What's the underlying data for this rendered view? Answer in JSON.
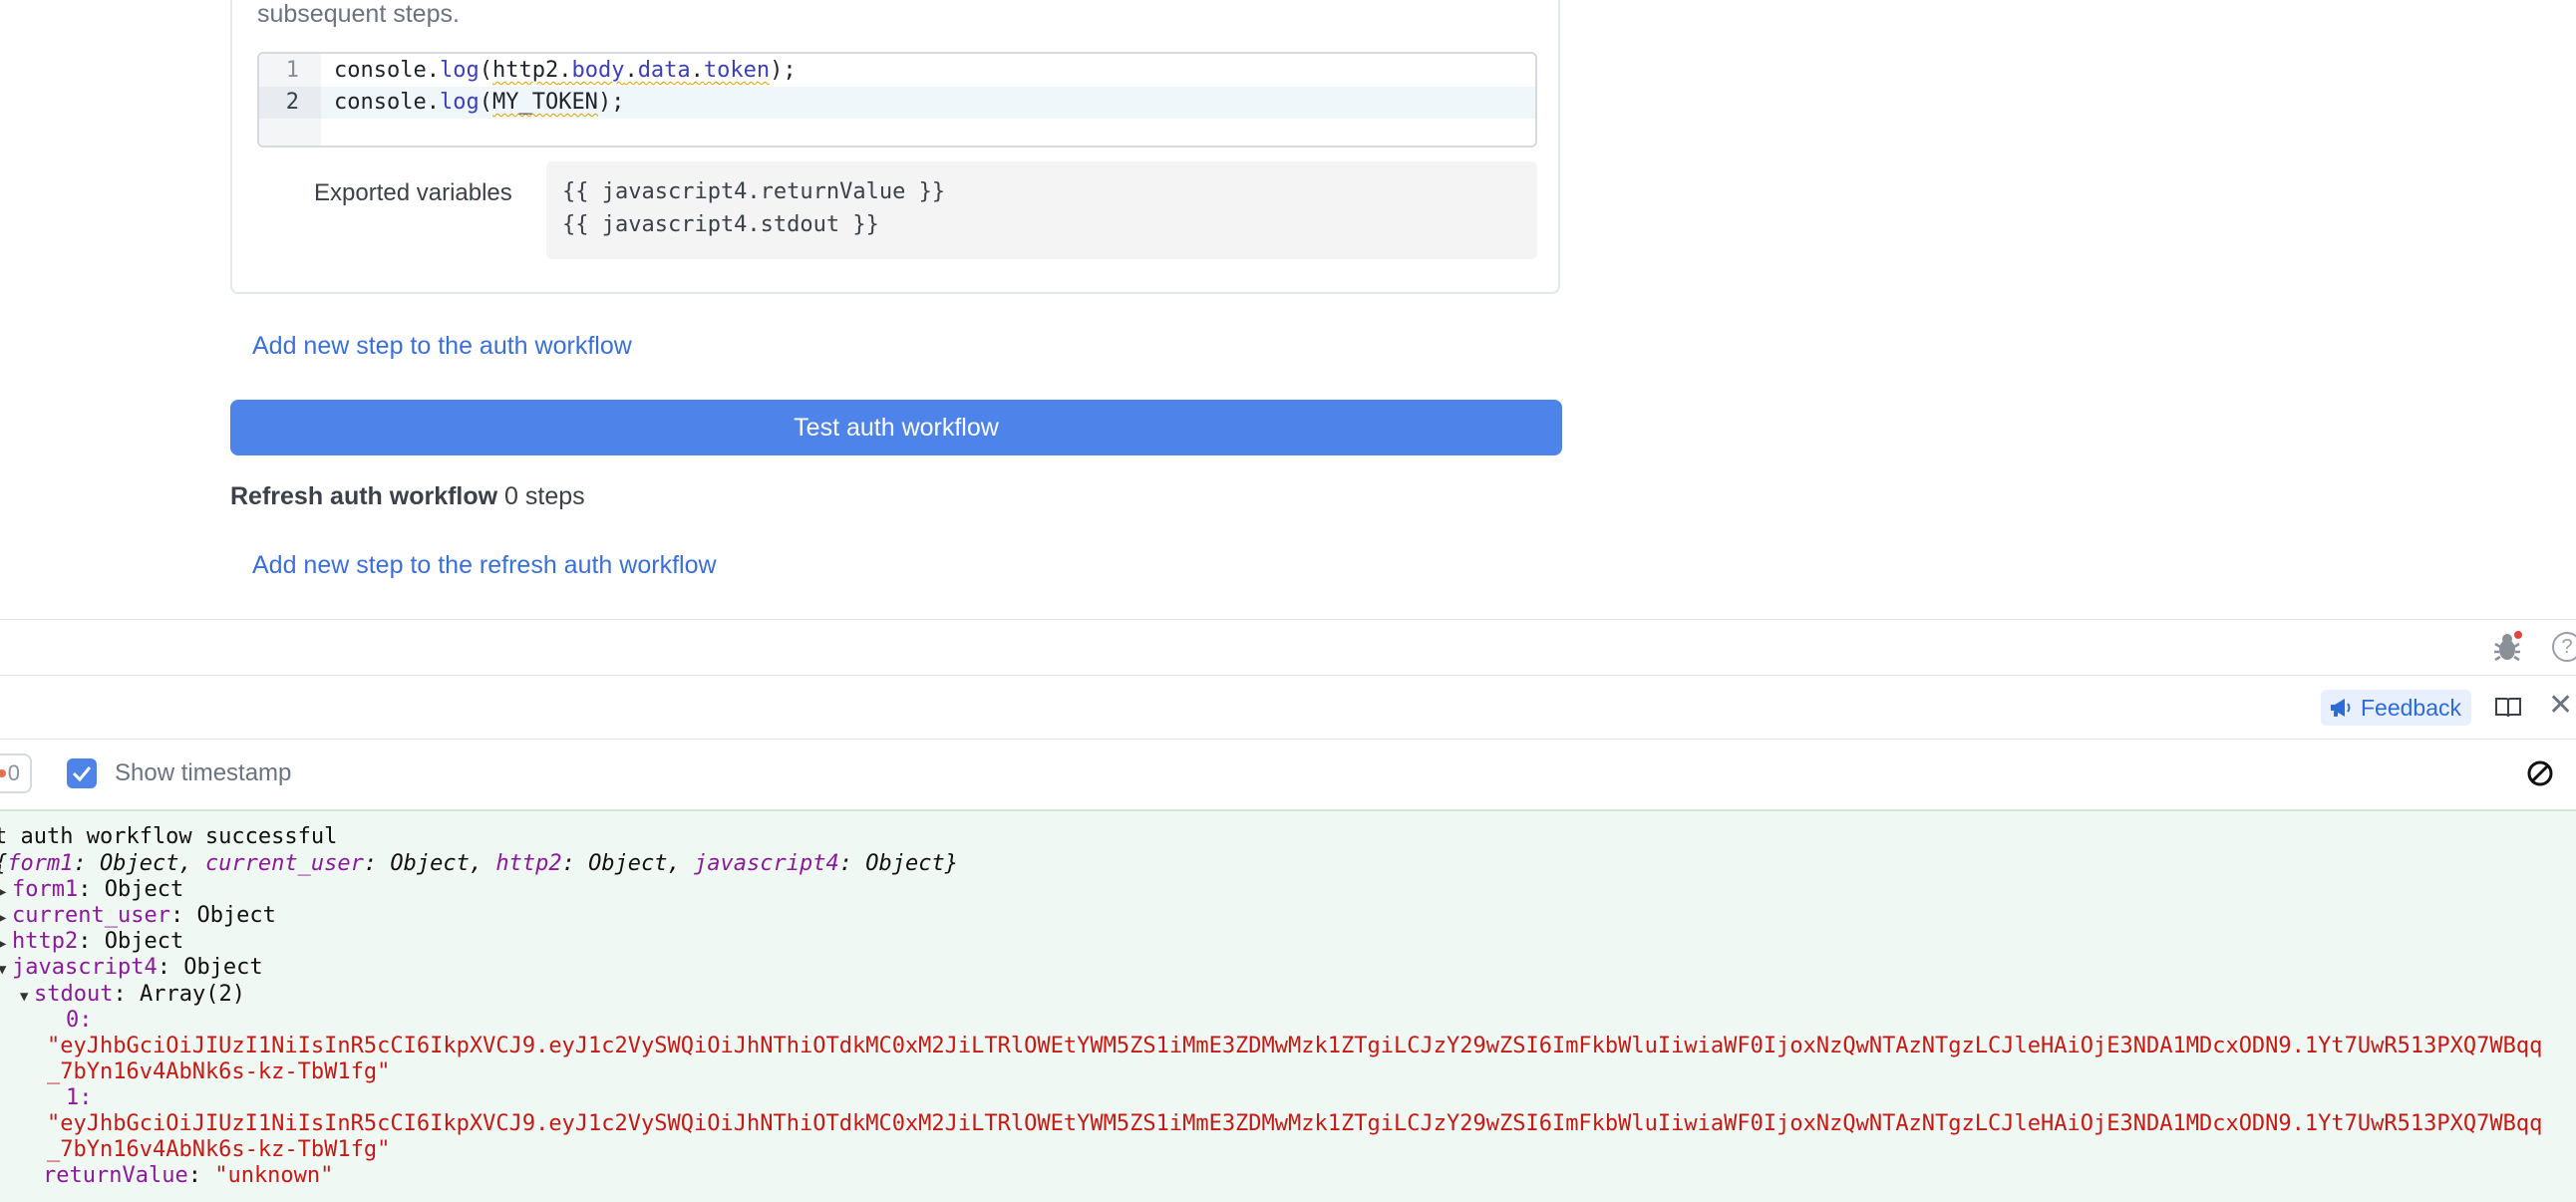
{
  "step": {
    "description_tail": "subsequent steps.",
    "code_lines": [
      {
        "num": "1",
        "pre": "console.",
        "fn": "log",
        "open": "(",
        "obj": "http2",
        "dot1": ".",
        "p1": "body",
        "dot2": ".",
        "p2": "data",
        "dot3": ".",
        "p3": "token",
        "close": ");"
      },
      {
        "num": "2",
        "pre": "console.",
        "fn": "log",
        "open": "(",
        "arg": "MY_TOKEN",
        "close": ");"
      }
    ],
    "exported_label": "Exported variables",
    "exported_values": [
      "{{ javascript4.returnValue }}",
      "{{ javascript4.stdout }}"
    ]
  },
  "links": {
    "add_auth_step": "Add new step to the auth workflow",
    "add_refresh_step": "Add new step to the refresh auth workflow"
  },
  "test_button": "Test auth workflow",
  "refresh": {
    "title": "Refresh auth workflow",
    "steps": "0 steps"
  },
  "panel": {
    "feedback": "Feedback",
    "count": "0",
    "show_timestamp": "Show timestamp",
    "show_timestamp_checked": true
  },
  "console": {
    "status": "t auth workflow successful",
    "summary": {
      "open": "{",
      "k1": "form1",
      "v1": ": Object, ",
      "k2": "current_user",
      "v2": ": Object, ",
      "k3": "http2",
      "v3": ": Object, ",
      "k4": "javascript4",
      "v4": ": Object}"
    },
    "entries": [
      {
        "key": "form1",
        "value": ": Object"
      },
      {
        "key": "current_user",
        "value": ": Object"
      },
      {
        "key": "http2",
        "value": ": Object"
      },
      {
        "key": "javascript4",
        "value": ": Object"
      }
    ],
    "stdout_key": "stdout",
    "stdout_value": ": Array(2)",
    "item0_key": "0:",
    "item0_line1": "\"eyJhbGciOiJIUzI1NiIsInR5cCI6IkpXVCJ9.eyJ1c2VySWQiOiJhNThiOTdkMC0xM2JiLTRlOWEtYWM5ZS1iMmE3ZDMwMzk1ZTgiLCJzY29wZSI6ImFkbWluIiwiaWF0IjoxNzQwNTAzNTgzLCJleHAiOjE3NDA1MDcxODN9.1Yt7UwR513PXQ7WBqq",
    "item0_line2": "_7bYn16v4AbNk6s-kz-TbW1fg\"",
    "item1_key": "1:",
    "item1_line1": "\"eyJhbGciOiJIUzI1NiIsInR5cCI6IkpXVCJ9.eyJ1c2VySWQiOiJhNThiOTdkMC0xM2JiLTRlOWEtYWM5ZS1iMmE3ZDMwMzk1ZTgiLCJzY29wZSI6ImFkbWluIiwiaWF0IjoxNzQwNTAzNTgzLCJleHAiOjE3NDA1MDcxODN9.1Yt7UwR513PXQ7WBqq",
    "item1_line2": "_7bYn16v4AbNk6s-kz-TbW1fg\"",
    "return_key": "returnValue",
    "return_sep": ": ",
    "return_value": "\"unknown\""
  },
  "colors": {
    "accent": "#4e83ea",
    "link": "#3b6fd8",
    "console_bg": "#f0f8f3",
    "key_purple": "#8a1a9a",
    "string_red": "#c41a16"
  },
  "icons": [
    "bug-icon",
    "help-icon",
    "megaphone-icon",
    "book-icon",
    "close-icon",
    "check-icon",
    "clear-console-icon"
  ]
}
